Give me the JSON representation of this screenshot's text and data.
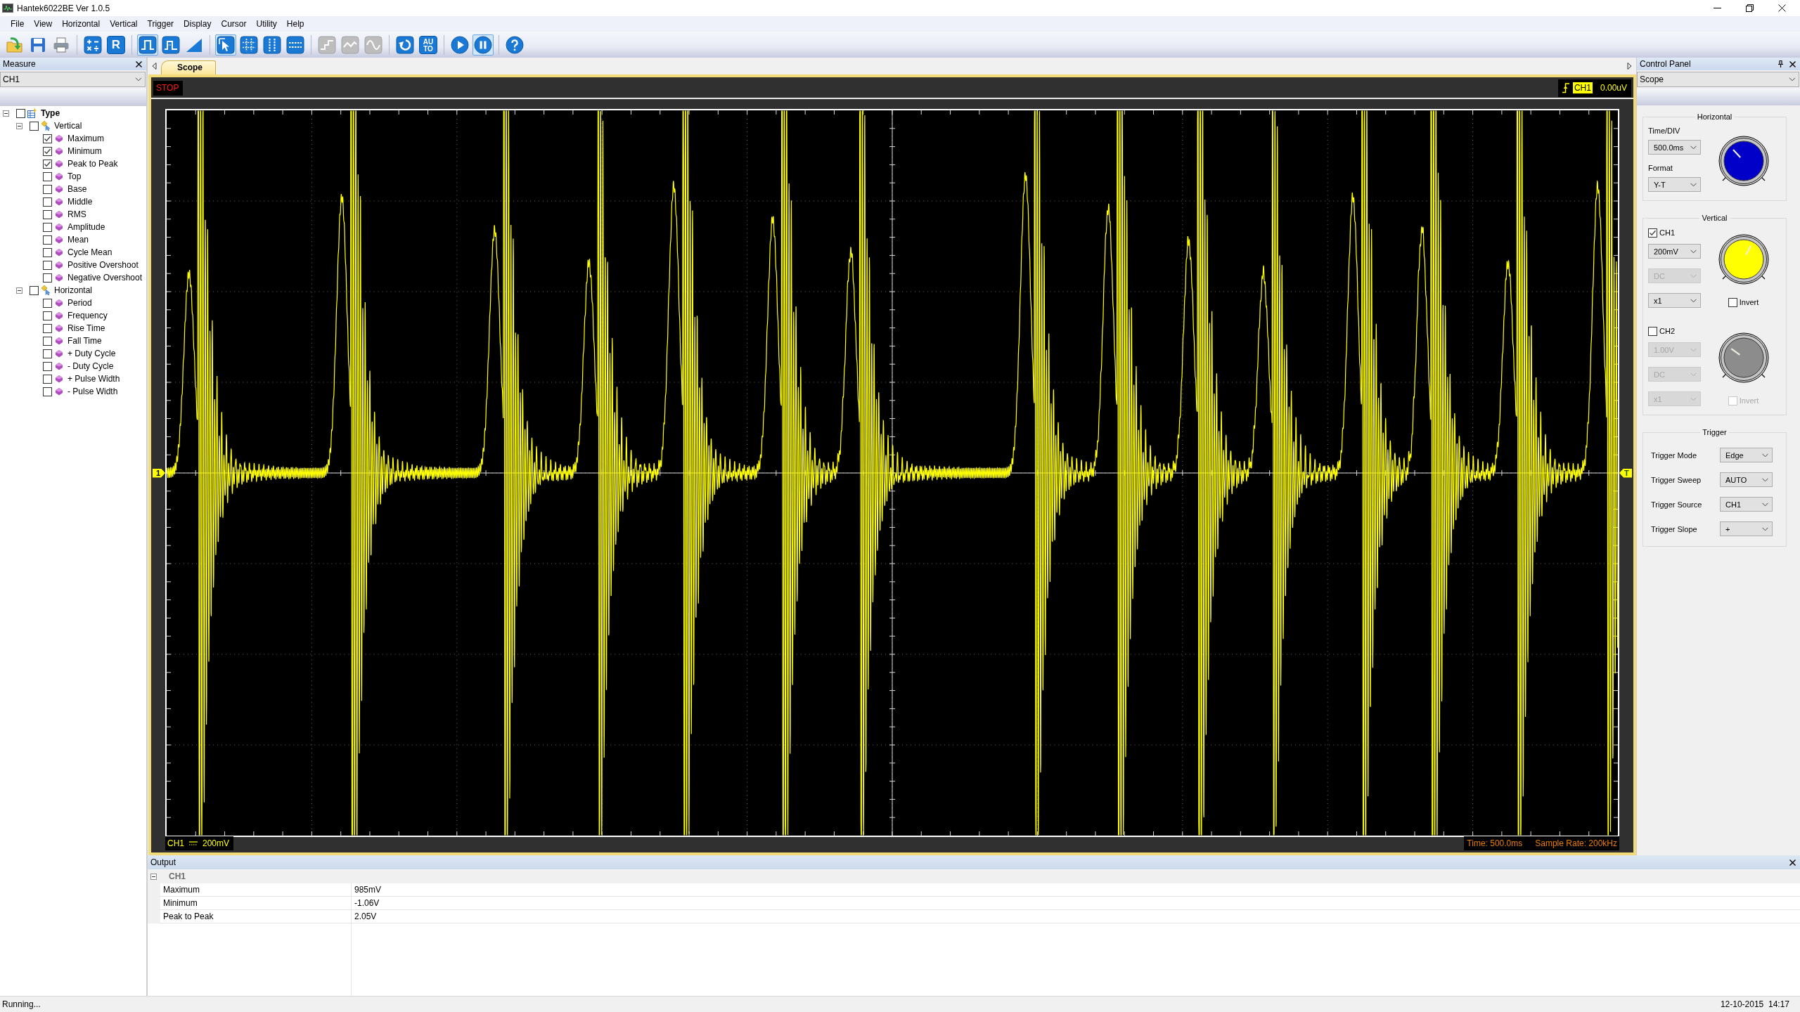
{
  "window": {
    "title": "Hantek6022BE Ver 1.0.5"
  },
  "menu": [
    "File",
    "View",
    "Horizontal",
    "Vertical",
    "Trigger",
    "Display",
    "Cursor",
    "Utility",
    "Help"
  ],
  "toolbar": {
    "groups": [
      {
        "items": [
          {
            "kind": "open",
            "on": false,
            "disabled": false
          },
          {
            "kind": "save",
            "on": false,
            "disabled": false
          },
          {
            "kind": "print",
            "on": false,
            "disabled": false
          }
        ]
      },
      {
        "items": [
          {
            "kind": "math",
            "on": false,
            "disabled": false
          },
          {
            "kind": "letter",
            "label": "R",
            "on": false,
            "disabled": false
          }
        ]
      },
      {
        "items": [
          {
            "kind": "pulse",
            "on": true,
            "disabled": false
          },
          {
            "kind": "pulse-width",
            "on": false,
            "disabled": false
          },
          {
            "kind": "ramp",
            "on": false,
            "disabled": false
          }
        ]
      },
      {
        "items": [
          {
            "kind": "pointer",
            "on": true,
            "disabled": false
          },
          {
            "kind": "grid",
            "on": false,
            "disabled": false
          },
          {
            "kind": "cursor-vertical",
            "on": false,
            "disabled": false
          },
          {
            "kind": "cursor-horizontal",
            "on": false,
            "disabled": false
          }
        ]
      },
      {
        "items": [
          {
            "kind": "step",
            "on": false,
            "disabled": true
          },
          {
            "kind": "wave",
            "on": false,
            "disabled": true
          },
          {
            "kind": "sine",
            "on": false,
            "disabled": true
          }
        ]
      },
      {
        "items": [
          {
            "kind": "rotate",
            "on": false,
            "disabled": false
          },
          {
            "kind": "stacked-letters",
            "label": "AUTO",
            "on": false,
            "disabled": false
          }
        ]
      },
      {
        "items": [
          {
            "kind": "run",
            "on": false,
            "disabled": false
          },
          {
            "kind": "pause",
            "on": true,
            "disabled": false
          }
        ]
      },
      {
        "items": [
          {
            "kind": "help",
            "on": false,
            "disabled": false
          }
        ]
      }
    ]
  },
  "measure_panel": {
    "title": "Measure",
    "channel": "CH1",
    "tree": [
      {
        "label": "Type",
        "checked": false,
        "expanded": true,
        "children": [
          {
            "label": "Vertical",
            "checked": false,
            "expanded": true,
            "children": [
              {
                "label": "Maximum",
                "checked": true
              },
              {
                "label": "Minimum",
                "checked": true
              },
              {
                "label": "Peak to Peak",
                "checked": true
              },
              {
                "label": "Top",
                "checked": false
              },
              {
                "label": "Base",
                "checked": false
              },
              {
                "label": "Middle",
                "checked": false
              },
              {
                "label": "RMS",
                "checked": false
              },
              {
                "label": "Amplitude",
                "checked": false
              },
              {
                "label": "Mean",
                "checked": false
              },
              {
                "label": "Cycle Mean",
                "checked": false
              },
              {
                "label": "Positive Overshoot",
                "checked": false
              },
              {
                "label": "Negative Overshoot",
                "checked": false
              }
            ]
          },
          {
            "label": "Horizontal",
            "checked": false,
            "expanded": true,
            "children": [
              {
                "label": "Period",
                "checked": false
              },
              {
                "label": "Frequency",
                "checked": false
              },
              {
                "label": "Rise Time",
                "checked": false
              },
              {
                "label": "Fall Time",
                "checked": false
              },
              {
                "label": "+ Duty Cycle",
                "checked": false
              },
              {
                "label": "- Duty Cycle",
                "checked": false
              },
              {
                "label": "+ Pulse Width",
                "checked": false
              },
              {
                "label": "- Pulse Width",
                "checked": false
              }
            ]
          }
        ]
      }
    ]
  },
  "document_tabs": [
    {
      "label": "Scope",
      "selected": true
    }
  ],
  "scope": {
    "run_state": "STOP",
    "trigger_readout": {
      "source": "CH1",
      "reading": "0.00uV"
    },
    "channel_marker": "1",
    "trigger_marker": "T",
    "channel_readout": {
      "channel": "CH1",
      "scale": "200mV"
    },
    "time_readout": "Time: 500.0ms",
    "sample_rate_readout": "Sample Rate: 200kHz"
  },
  "control_panel": {
    "title": "Control Panel",
    "view": "Scope",
    "horizontal": {
      "title": "Horizontal",
      "time_div_label": "Time/DIV",
      "time_div": {
        "value": "500.0ms",
        "disabled": false
      },
      "format_label": "Format",
      "format": {
        "value": "Y-T",
        "disabled": false
      },
      "knob": {
        "color": "#0000c8",
        "level": 0.34
      }
    },
    "vertical": {
      "title": "Vertical",
      "channels": [
        {
          "label": "CH1",
          "checked": true,
          "scale": {
            "value": "200mV",
            "disabled": false
          },
          "coupling": {
            "value": "DC",
            "disabled": true
          },
          "probe": {
            "value": "x1",
            "disabled": false
          },
          "knob": {
            "color": "#ffff00",
            "level": 0.6
          },
          "invert": {
            "label": "Invert",
            "checked": false,
            "disabled": false
          }
        },
        {
          "label": "CH2",
          "checked": false,
          "scale": {
            "value": "1.00V",
            "disabled": true
          },
          "coupling": {
            "value": "DC",
            "disabled": true
          },
          "probe": {
            "value": "x1",
            "disabled": true
          },
          "knob": {
            "color": "#8c8c8c",
            "level": 0.3
          },
          "invert": {
            "label": "Invert",
            "checked": false,
            "disabled": true
          }
        }
      ]
    },
    "trigger": {
      "title": "Trigger",
      "rows": [
        {
          "label": "Trigger Mode",
          "value": "Edge",
          "disabled": false
        },
        {
          "label": "Trigger Sweep",
          "value": "AUTO",
          "disabled": false
        },
        {
          "label": "Trigger Source",
          "value": "CH1",
          "disabled": false
        },
        {
          "label": "Trigger Slope",
          "value": "+",
          "disabled": false
        }
      ]
    }
  },
  "output": {
    "title": "Output",
    "groups": [
      {
        "label": "CH1",
        "expanded": true,
        "rows": [
          {
            "name": "Maximum",
            "value": "985mV"
          },
          {
            "name": "Minimum",
            "value": "-1.06V"
          },
          {
            "name": "Peak to Peak",
            "value": "2.05V"
          }
        ]
      }
    ]
  },
  "status_bar": {
    "message": "Running...",
    "datetime": "12-10-2015  14:17"
  }
}
